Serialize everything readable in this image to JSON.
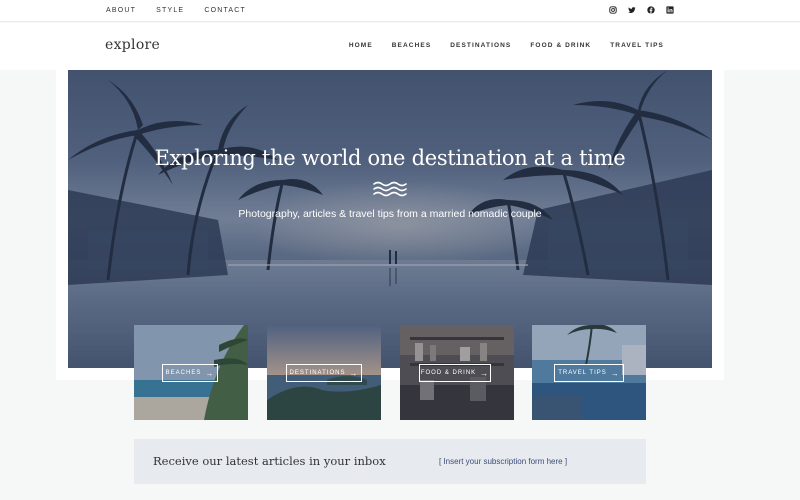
{
  "topbar": {
    "links": [
      "ABOUT",
      "STYLE",
      "CONTACT"
    ],
    "social": [
      "instagram-icon",
      "twitter-icon",
      "facebook-icon",
      "linkedin-icon"
    ]
  },
  "header": {
    "logo": "explore",
    "nav": [
      "HOME",
      "BEACHES",
      "DESTINATIONS",
      "FOOD & DRINK",
      "TRAVEL TIPS"
    ]
  },
  "hero": {
    "title": "Exploring the world one destination at a time",
    "subtitle": "Photography, articles & travel tips from a married nomadic couple"
  },
  "categories": [
    {
      "label": "BEACHES",
      "arrow": "→"
    },
    {
      "label": "DESTINATIONS",
      "arrow": "→"
    },
    {
      "label": "FOOD & DRINK",
      "arrow": "→"
    },
    {
      "label": "TRAVEL TIPS",
      "arrow": "→"
    }
  ],
  "subscribe": {
    "title": "Receive our latest articles in your inbox",
    "form_placeholder": "[ Insert your subscription form here ]"
  },
  "colors": {
    "accent": "#3c4d78",
    "hero_overlay": "#2d3c5f",
    "subscribe_bg": "#e7eaef"
  }
}
